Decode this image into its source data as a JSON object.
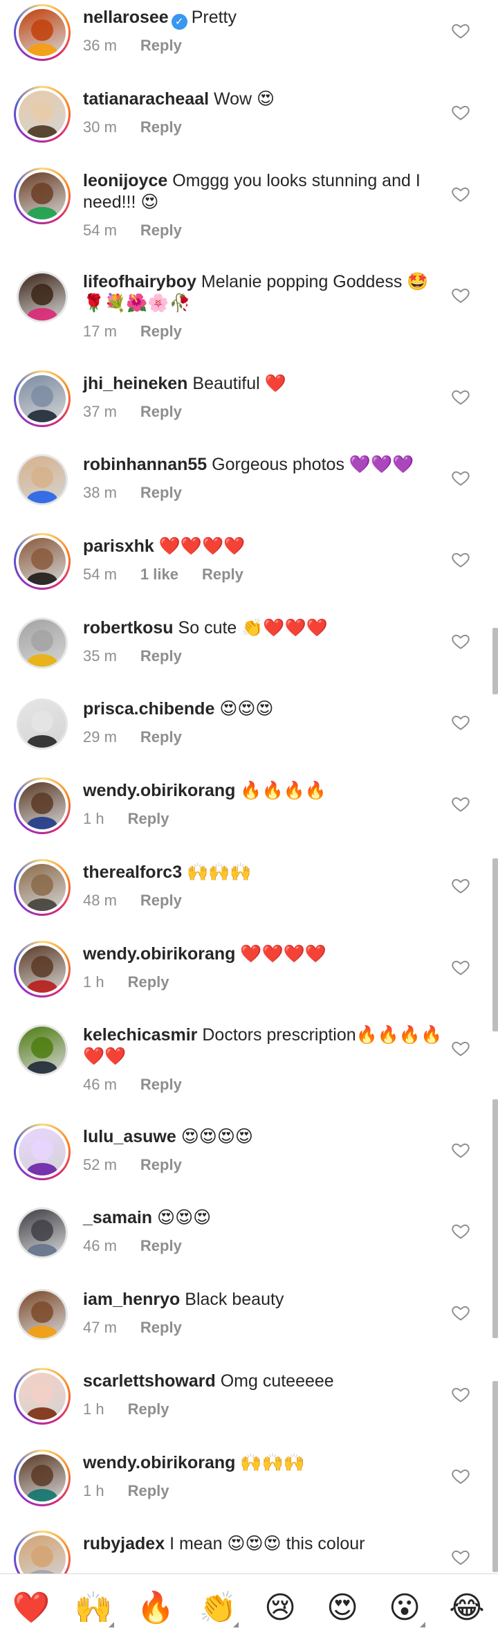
{
  "reply_label": "Reply",
  "colors": {
    "verified": "#3897f0",
    "muted": "#8e8e8e",
    "text": "#262626"
  },
  "comments": [
    {
      "username": "nellarosee",
      "verified": true,
      "text": "Pretty",
      "time": "36 m",
      "likes": "",
      "story_ring": true,
      "avatar_colors": [
        "#c2410c",
        "#f59e0b"
      ]
    },
    {
      "username": "tatianaracheaal",
      "verified": false,
      "text": "Wow 😍",
      "time": "30 m",
      "likes": "",
      "story_ring": true,
      "avatar_colors": [
        "#e7cba9",
        "#4b3621"
      ]
    },
    {
      "username": "leonijoyce",
      "verified": false,
      "text": "Omggg you looks stunning and I need!!! 😍",
      "time": "54 m",
      "likes": "",
      "story_ring": true,
      "avatar_colors": [
        "#6b3e26",
        "#16a34a"
      ]
    },
    {
      "username": "lifeofhairyboy",
      "verified": false,
      "text": "Melanie popping Goddess 🤩🌹💐🌺🌸🥀",
      "time": "17 m",
      "likes": "",
      "story_ring": false,
      "avatar_colors": [
        "#3b2418",
        "#db2777"
      ]
    },
    {
      "username": "jhi_heineken",
      "verified": false,
      "text": "Beautiful ❤️",
      "time": "37 m",
      "likes": "",
      "story_ring": true,
      "avatar_colors": [
        "#7c8ca3",
        "#1f2937"
      ]
    },
    {
      "username": "robinhannan55",
      "verified": false,
      "text": "Gorgeous photos 💜💜💜",
      "time": "38 m",
      "likes": "",
      "story_ring": false,
      "avatar_colors": [
        "#d6b18a",
        "#2563eb"
      ]
    },
    {
      "username": "parisxhk",
      "verified": false,
      "text": "❤️❤️❤️❤️",
      "time": "54 m",
      "likes": "1 like",
      "story_ring": true,
      "avatar_colors": [
        "#8a5a3c",
        "#1c1917"
      ]
    },
    {
      "username": "robertkosu",
      "verified": false,
      "text": "So cute 👏❤️❤️❤️",
      "time": "35 m",
      "likes": "",
      "story_ring": false,
      "avatar_colors": [
        "#a3a3a3",
        "#eab308"
      ]
    },
    {
      "username": "prisca.chibende",
      "verified": false,
      "text": "😍😍😍",
      "time": "29 m",
      "likes": "",
      "story_ring": false,
      "avatar_colors": [
        "#e5e5e5",
        "#262626"
      ]
    },
    {
      "username": "wendy.obirikorang",
      "verified": false,
      "text": "🔥🔥🔥🔥",
      "time": "1 h",
      "likes": "",
      "story_ring": true,
      "avatar_colors": [
        "#5a3a26",
        "#1e3a8a"
      ]
    },
    {
      "username": "therealforc3",
      "verified": false,
      "text": "🙌🙌🙌",
      "time": "48 m",
      "likes": "",
      "story_ring": true,
      "avatar_colors": [
        "#8b6b4a",
        "#44403c"
      ]
    },
    {
      "username": "wendy.obirikorang",
      "verified": false,
      "text": "❤️❤️❤️❤️",
      "time": "1 h",
      "likes": "",
      "story_ring": true,
      "avatar_colors": [
        "#5a3a26",
        "#b91c1c"
      ]
    },
    {
      "username": "kelechicasmir",
      "verified": false,
      "text": "Doctors prescription🔥🔥🔥🔥❤️❤️",
      "time": "46 m",
      "likes": "",
      "story_ring": false,
      "avatar_colors": [
        "#4d7c0f",
        "#1f2937"
      ]
    },
    {
      "username": "lulu_asuwe",
      "verified": false,
      "text": "😍😍😍😍",
      "time": "52 m",
      "likes": "",
      "story_ring": true,
      "avatar_colors": [
        "#e9d5ff",
        "#6b21a8"
      ]
    },
    {
      "username": "_samain",
      "verified": false,
      "text": "😍😍😍",
      "time": "46 m",
      "likes": "",
      "story_ring": false,
      "avatar_colors": [
        "#3f3f46",
        "#64748b"
      ]
    },
    {
      "username": "iam_henryo",
      "verified": false,
      "text": "Black beauty",
      "time": "47 m",
      "likes": "",
      "story_ring": false,
      "avatar_colors": [
        "#7c4a2a",
        "#f59e0b"
      ]
    },
    {
      "username": "scarlettshoward",
      "verified": false,
      "text": "Omg cuteeeee",
      "time": "1 h",
      "likes": "",
      "story_ring": true,
      "avatar_colors": [
        "#f5d0c5",
        "#7c2d12"
      ]
    },
    {
      "username": "wendy.obirikorang",
      "verified": false,
      "text": "🙌🙌🙌",
      "time": "1 h",
      "likes": "",
      "story_ring": true,
      "avatar_colors": [
        "#5a3a26",
        "#0f766e"
      ]
    },
    {
      "username": "rubyjadex",
      "verified": false,
      "text": "I mean 😍😍😍 this colour",
      "time": "",
      "likes": "",
      "story_ring": true,
      "avatar_colors": [
        "#d4a373",
        "#9ca3af"
      ]
    }
  ],
  "reactions": [
    {
      "emoji": "❤️",
      "name": "heart"
    },
    {
      "emoji": "🙌",
      "name": "raising-hands"
    },
    {
      "emoji": "🔥",
      "name": "fire"
    },
    {
      "emoji": "👏",
      "name": "clapping-hands"
    },
    {
      "emoji": "😢",
      "name": "crying-face"
    },
    {
      "emoji": "😍",
      "name": "heart-eyes"
    },
    {
      "emoji": "😮",
      "name": "open-mouth"
    },
    {
      "emoji": "😂",
      "name": "tears-of-joy"
    }
  ]
}
